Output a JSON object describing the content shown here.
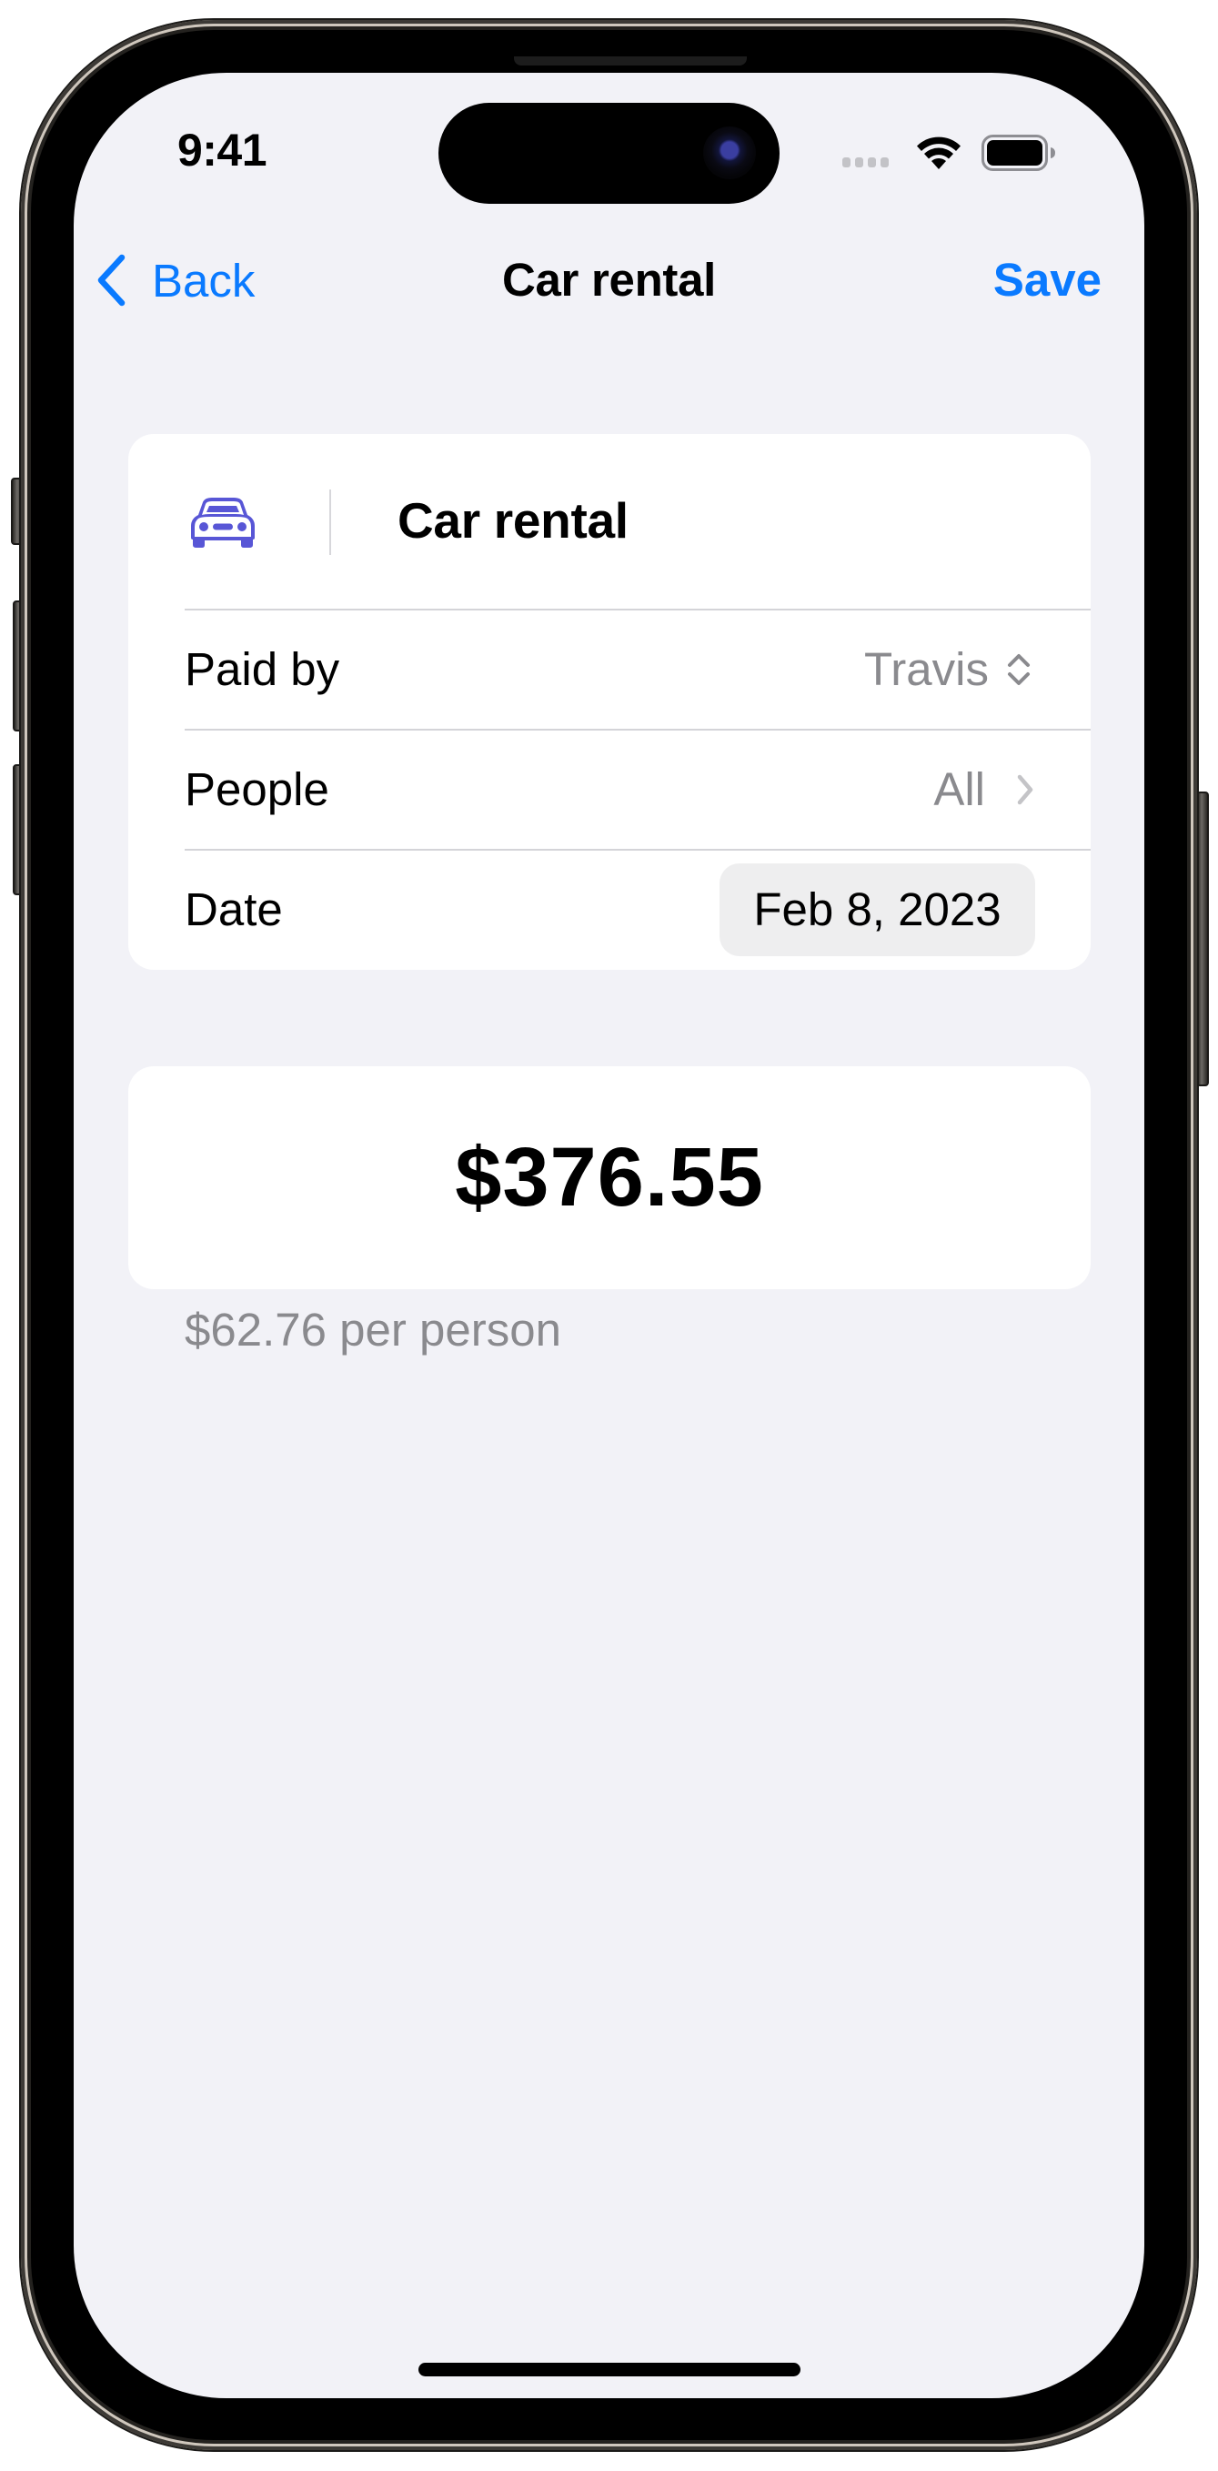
{
  "status_bar": {
    "time": "9:41",
    "icons": [
      "signal-dots-icon",
      "wifi-icon",
      "battery-icon"
    ]
  },
  "nav": {
    "back_label": "Back",
    "title": "Car rental",
    "save_label": "Save",
    "accent_color": "#0A7AFF"
  },
  "expense": {
    "icon": "car-icon",
    "icon_color": "#5856D6",
    "title": "Car rental",
    "rows": [
      {
        "label": "Paid by",
        "value": "Travis",
        "control": "popup-updown-icon"
      },
      {
        "label": "People",
        "value": "All",
        "control": "chevron-right-icon"
      },
      {
        "label": "Date",
        "value": "Feb 8, 2023",
        "control": "date-picker"
      }
    ]
  },
  "amount": {
    "total": "$376.55",
    "per_person": "$62.76 per person"
  }
}
